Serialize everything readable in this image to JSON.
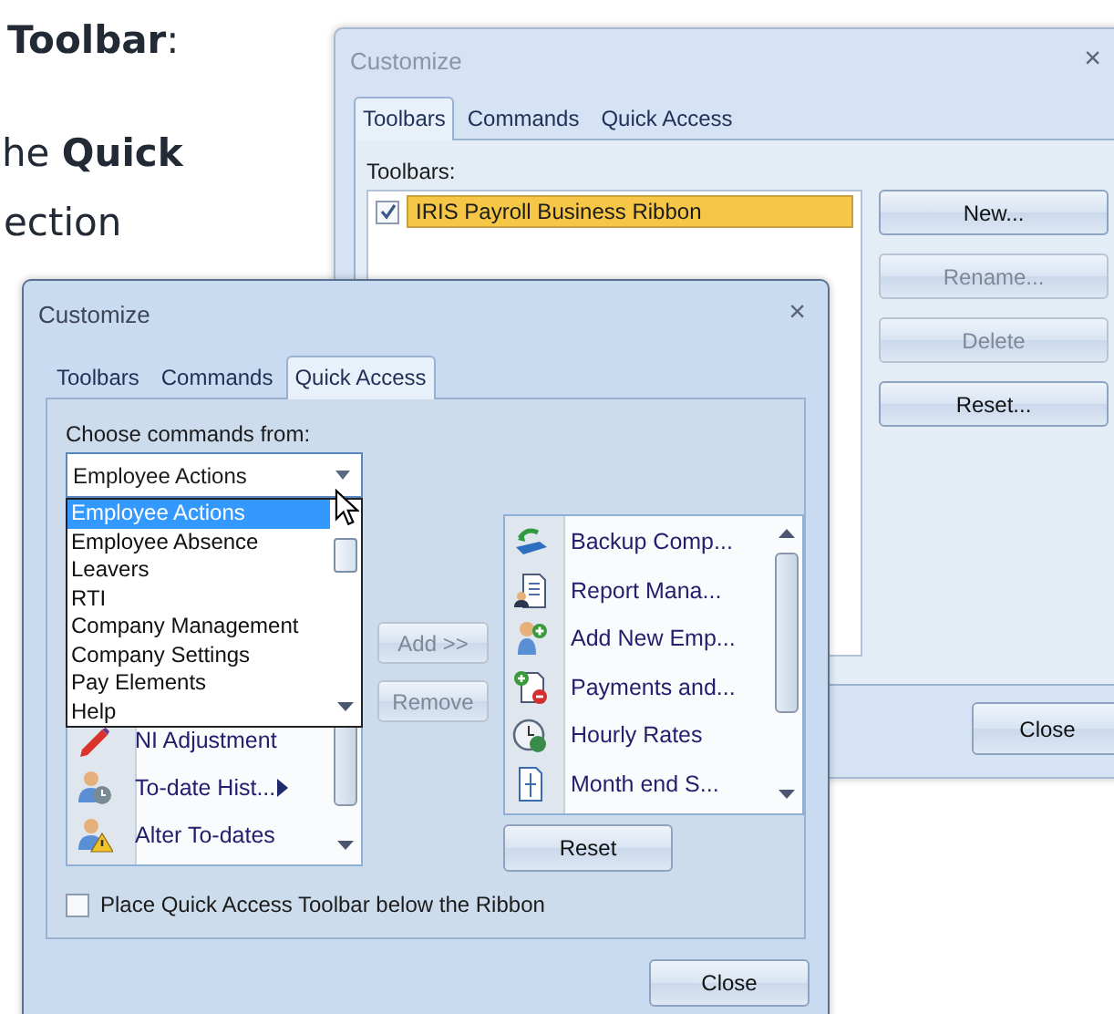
{
  "article": {
    "lines": [
      "**Toolbar**:",
      "he **Quick**",
      "ection"
    ]
  },
  "back_dialog": {
    "title": "Customize",
    "close": "×",
    "tabs": [
      {
        "label": "Toolbars",
        "selected": true
      },
      {
        "label": "Commands",
        "selected": false
      },
      {
        "label": "Quick Access",
        "selected": false
      }
    ],
    "group_label": "Toolbars:",
    "toolbars": [
      {
        "label": "IRIS Payroll Business Ribbon",
        "checked": true,
        "selected": true
      }
    ],
    "buttons": [
      {
        "label": "New...",
        "disabled": false
      },
      {
        "label": "Rename...",
        "disabled": true
      },
      {
        "label": "Delete",
        "disabled": true
      },
      {
        "label": "Reset...",
        "disabled": false
      }
    ],
    "close_button": "Close"
  },
  "front_dialog": {
    "title": "Customize",
    "close": "×",
    "tabs": [
      {
        "label": "Toolbars",
        "selected": false
      },
      {
        "label": "Commands",
        "selected": false
      },
      {
        "label": "Quick Access",
        "selected": true
      }
    ],
    "source_label": "Choose commands from:",
    "source": {
      "value": "Employee Actions",
      "expanded": true
    },
    "options": [
      {
        "label": "Employee Actions",
        "selected": true
      },
      {
        "label": "Employee Absence",
        "selected": false
      },
      {
        "label": "Leavers",
        "selected": false
      },
      {
        "label": "RTI",
        "selected": false
      },
      {
        "label": "Company Management",
        "selected": false
      },
      {
        "label": "Company Settings",
        "selected": false
      },
      {
        "label": "Pay Elements",
        "selected": false
      },
      {
        "label": "Help",
        "selected": false
      }
    ],
    "commands": [
      {
        "label": "NI Adjustment",
        "submenu": false
      },
      {
        "label": "To-date Hist...",
        "submenu": true
      },
      {
        "label": "Alter To-dates",
        "submenu": false
      }
    ],
    "add_button": {
      "label": "Add >>",
      "disabled": true
    },
    "remove_button": {
      "label": "Remove",
      "disabled": true
    },
    "quick_access": [
      "Backup Comp...",
      "Report Mana...",
      "Add New Emp...",
      "Payments and...",
      "Hourly Rates",
      "Month end S..."
    ],
    "reset_button": "Reset",
    "option": {
      "label": "Place Quick Access Toolbar below the Ribbon",
      "checked": false
    },
    "close_button": "Close"
  }
}
